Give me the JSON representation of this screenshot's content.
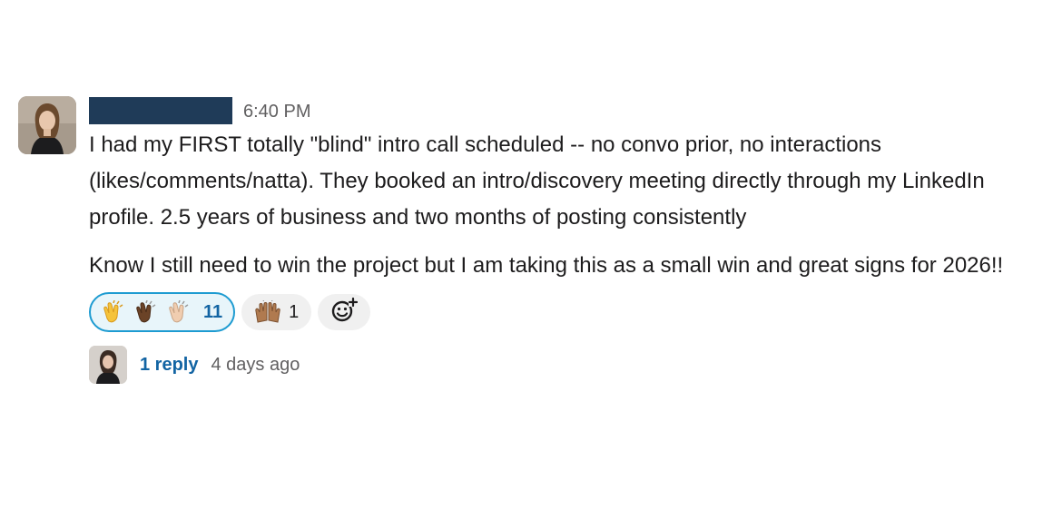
{
  "message": {
    "author": "",
    "timestamp": "6:40 PM",
    "paragraphs": [
      "I had my FIRST totally \"blind\" intro call scheduled -- no convo prior, no interactions (likes/comments/natta). They booked an intro/discovery meeting directly through my LinkedIn profile. 2.5 years of business and two months of posting consistently",
      "Know I still need to win the project but I am taking this as a small win and great signs for 2026!!"
    ]
  },
  "reactions": [
    {
      "emoji": "clapping-hands-skin-tones",
      "count": "11",
      "active": true
    },
    {
      "emoji": "raising-hands",
      "count": "1",
      "active": false
    }
  ],
  "thread": {
    "reply_count_label": "1 reply",
    "last_reply_time": "4 days ago"
  },
  "colors": {
    "link": "#1264a3",
    "active_reaction_border": "#1d9bd1",
    "active_reaction_bg": "#e8f5fa",
    "redaction": "#1f3b58"
  }
}
